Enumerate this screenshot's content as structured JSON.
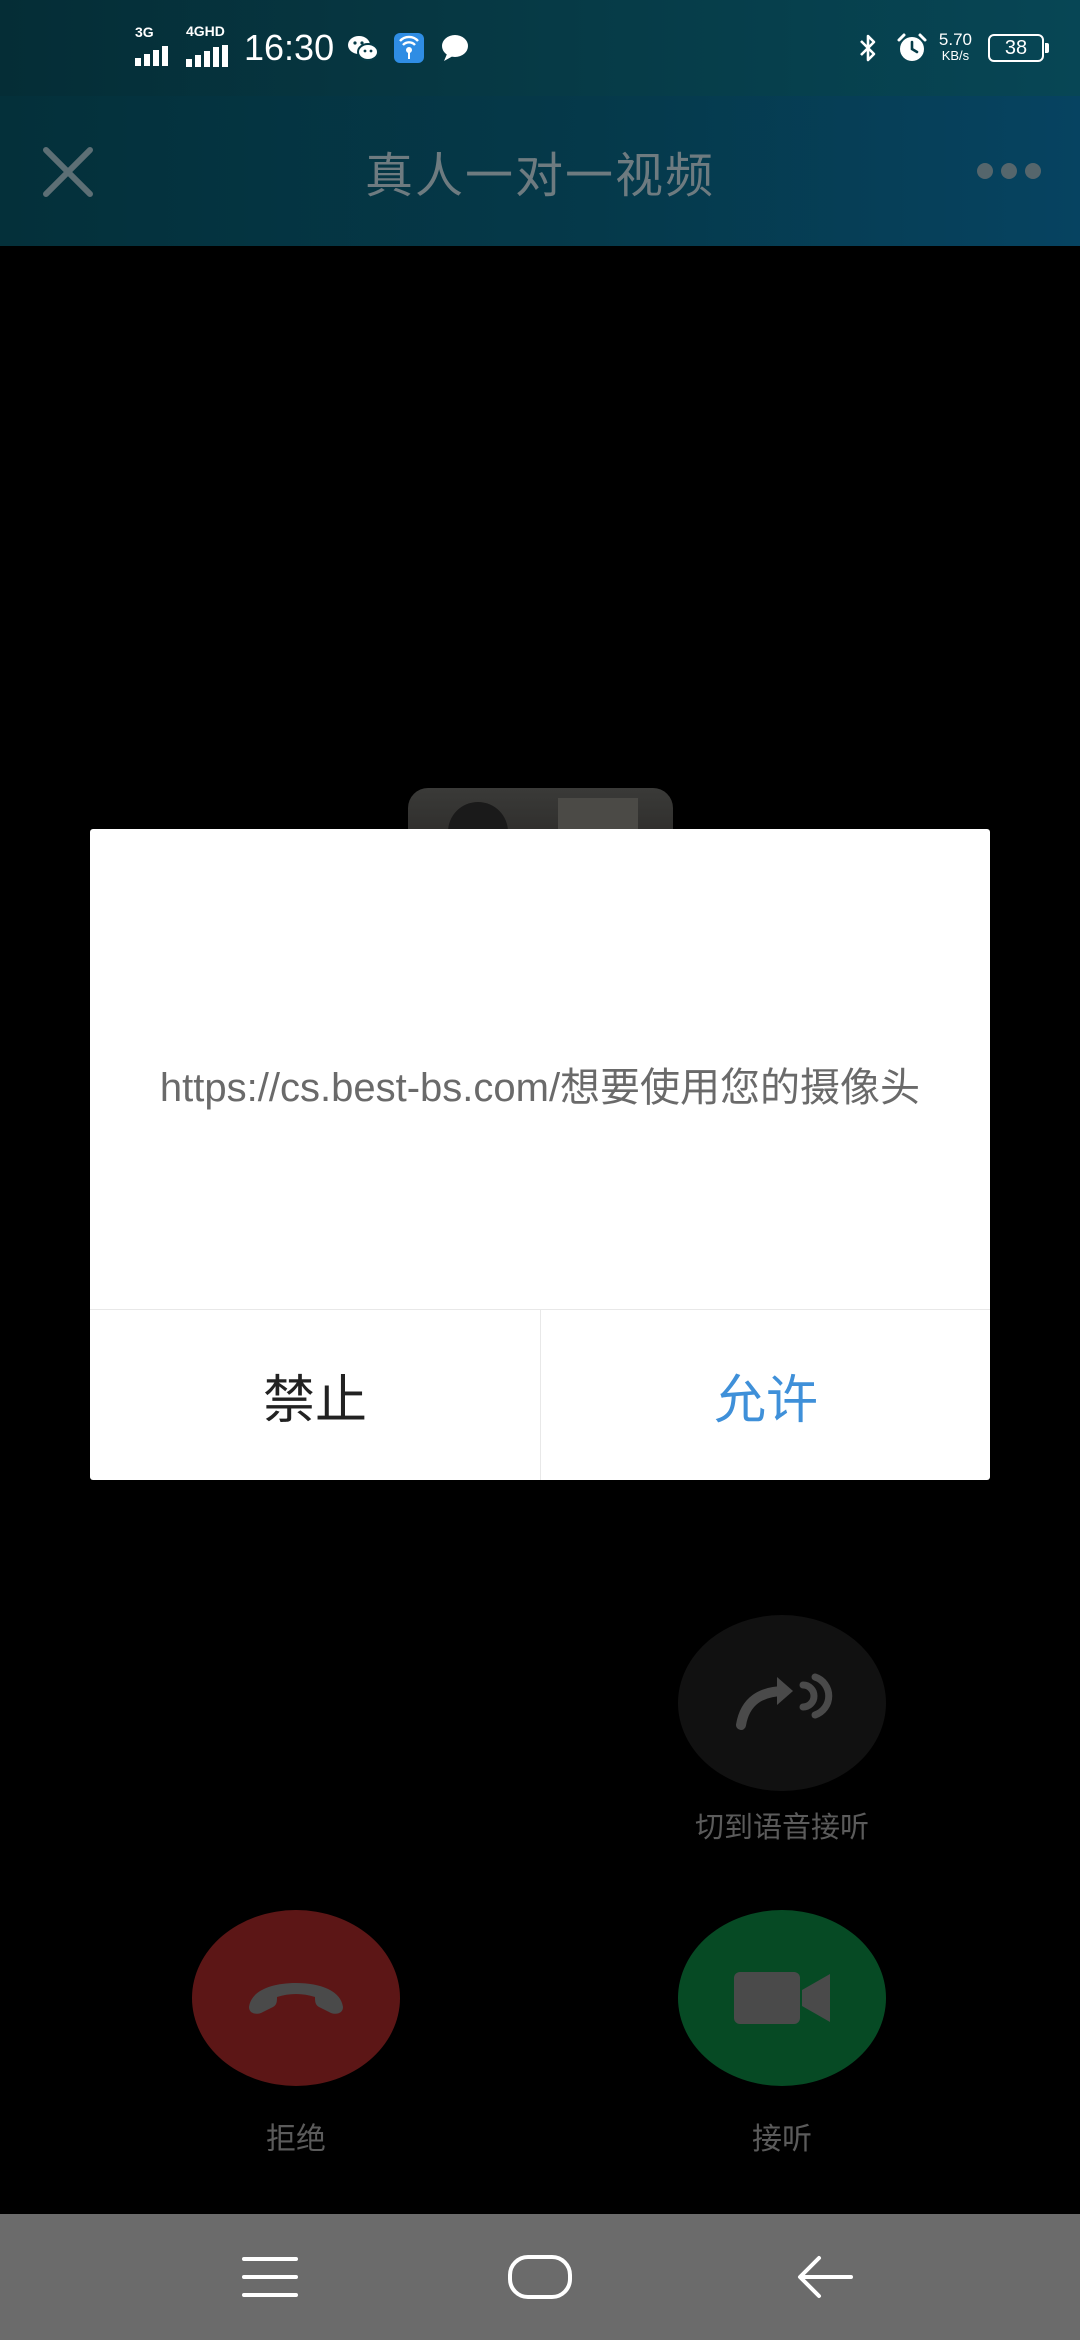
{
  "status_bar": {
    "signal1_label": "3G",
    "signal2_label": "4GHD",
    "time": "16:30",
    "net_speed_value": "5.70",
    "net_speed_unit": "KB/s",
    "battery": "38",
    "icons": [
      "wechat-icon",
      "hotspot-app-icon",
      "message-bubble-icon",
      "bluetooth-icon",
      "alarm-icon"
    ]
  },
  "title_bar": {
    "title": "真人一对一视频",
    "close_icon": "close-icon",
    "more_icon": "more-icon"
  },
  "dialog": {
    "message": "https://cs.best-bs.com/想要使用您的摄像头",
    "deny_label": "禁止",
    "allow_label": "允许",
    "allow_color": "#3f90d9"
  },
  "call": {
    "voice_label": "切到语音接听",
    "decline_label": "拒绝",
    "accept_label": "接听",
    "decline_color": "#5c1616",
    "accept_color": "#064a24"
  },
  "nav_bar": {
    "icons": [
      "menu-icon",
      "home-icon",
      "back-icon"
    ]
  }
}
